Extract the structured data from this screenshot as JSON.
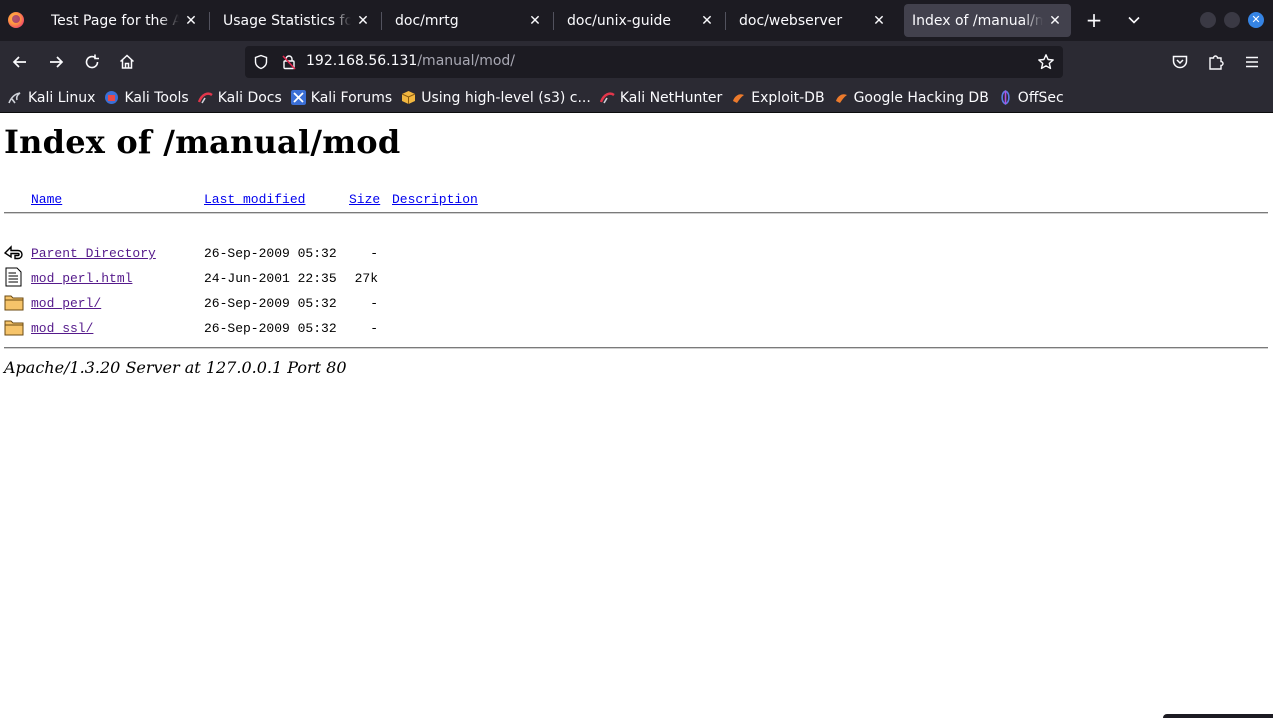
{
  "browser": {
    "tabs": [
      {
        "label": "Test Page for the Apache",
        "active": false
      },
      {
        "label": "Usage Statistics for k",
        "active": false
      },
      {
        "label": "doc/mrtg",
        "active": false
      },
      {
        "label": "doc/unix-guide",
        "active": false
      },
      {
        "label": "doc/webserver",
        "active": false
      },
      {
        "label": "Index of /manual/mod",
        "active": true
      }
    ],
    "url_host": "192.168.56.131",
    "url_path": "/manual/mod/",
    "bookmarks": [
      {
        "label": "Kali Linux",
        "icon": "kali-dragon-icon"
      },
      {
        "label": "Kali Tools",
        "icon": "kali-tools-icon"
      },
      {
        "label": "Kali Docs",
        "icon": "kali-docs-icon"
      },
      {
        "label": "Kali Forums",
        "icon": "kali-forums-icon"
      },
      {
        "label": "Using high-level (s3) c...",
        "icon": "aws-box-icon"
      },
      {
        "label": "Kali NetHunter",
        "icon": "kali-nethunter-icon"
      },
      {
        "label": "Exploit-DB",
        "icon": "exploit-db-icon"
      },
      {
        "label": "Google Hacking DB",
        "icon": "ghdb-icon"
      },
      {
        "label": "OffSec",
        "icon": "offsec-icon"
      }
    ]
  },
  "page": {
    "title": "Index of /manual/mod",
    "headers": {
      "name": "Name",
      "modified": "Last modified",
      "size": "Size",
      "description": "Description"
    },
    "rows": [
      {
        "icon": "back-arrow-icon",
        "name": "Parent Directory",
        "modified": "26-Sep-2009 05:32",
        "size": "-"
      },
      {
        "icon": "text-file-icon",
        "name": "mod_perl.html",
        "modified": "24-Jun-2001 22:35",
        "size": "27k"
      },
      {
        "icon": "folder-icon",
        "name": "mod_perl/",
        "modified": "26-Sep-2009 05:32",
        "size": "-"
      },
      {
        "icon": "folder-icon",
        "name": "mod_ssl/",
        "modified": "26-Sep-2009 05:32",
        "size": "-"
      }
    ],
    "footer": "Apache/1.3.20 Server at 127.0.0.1 Port 80"
  }
}
